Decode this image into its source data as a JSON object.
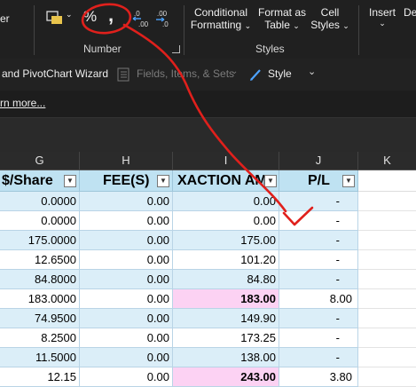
{
  "ribbon": {
    "left_cut_label": "er",
    "percent_symbol": "%",
    "comma_symbol": ",",
    "inc_dec_top": ".00",
    "inc_dec_bottom": "→.0",
    "dec_dec_top": ".00",
    "dec_dec_bottom": "→.0",
    "number_group": "Number",
    "conditional_formatting": [
      "Conditional",
      "Formatting"
    ],
    "format_as_table": [
      "Format as",
      "Table"
    ],
    "cell_styles": [
      "Cell",
      "Styles"
    ],
    "styles_group": "Styles",
    "insert": "Insert",
    "delete_cut": "De"
  },
  "toolbar2": {
    "pivot_wizard": "and PivotChart Wizard",
    "fields_items": "Fields, Items, & Sets",
    "style": "Style"
  },
  "toolbar3": {
    "learn_more": "rn more..."
  },
  "columns": [
    "G",
    "H",
    "I",
    "J",
    "K"
  ],
  "headers": [
    "$/Share",
    "FEE(S)",
    "XACTION AM",
    "P/L"
  ],
  "rows": [
    {
      "g": "0.0000",
      "h": "0.00",
      "i": "0.00",
      "j": "-",
      "style": "alt"
    },
    {
      "g": "0.0000",
      "h": "0.00",
      "i": "0.00",
      "j": "-",
      "style": "wh"
    },
    {
      "g": "175.0000",
      "h": "0.00",
      "i": "175.00",
      "j": "-",
      "style": "alt"
    },
    {
      "g": "12.6500",
      "h": "0.00",
      "i": "101.20",
      "j": "-",
      "style": "wh"
    },
    {
      "g": "84.8000",
      "h": "0.00",
      "i": "84.80",
      "j": "-",
      "style": "alt"
    },
    {
      "g": "183.0000",
      "h": "0.00",
      "i": "183.00",
      "j": "8.00",
      "style": "wh",
      "i_pink": true
    },
    {
      "g": "74.9500",
      "h": "0.00",
      "i": "149.90",
      "j": "-",
      "style": "alt"
    },
    {
      "g": "8.2500",
      "h": "0.00",
      "i": "173.25",
      "j": "-",
      "style": "wh"
    },
    {
      "g": "11.5000",
      "h": "0.00",
      "i": "138.00",
      "j": "-",
      "style": "alt"
    },
    {
      "g": "12.15",
      "h": "0.00",
      "i": "243.00",
      "j": "3.80",
      "style": "wh",
      "i_pink": true
    }
  ],
  "colors": {
    "annotation": "#e0201c",
    "header_fill": "#bfe2f2",
    "row_alt": "#dbeef8",
    "highlight": "#fcd2f3"
  }
}
